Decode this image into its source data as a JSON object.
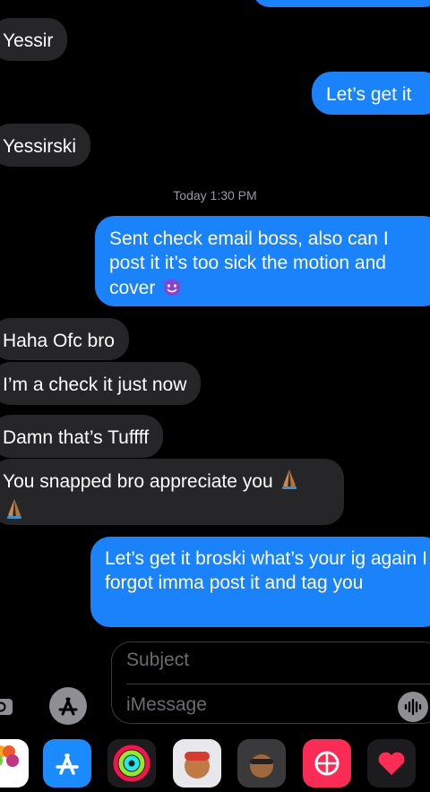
{
  "messages": [
    {
      "direction": "outgoing",
      "text": ""
    },
    {
      "direction": "incoming",
      "text": "Yessir"
    },
    {
      "direction": "outgoing",
      "text": "Let’s get it"
    },
    {
      "direction": "incoming",
      "text": "Yessirski"
    },
    {
      "direction": "outgoing",
      "text": "Sent check email boss, also can I post it it’s too sick the motion and cover"
    },
    {
      "direction": "incoming",
      "text": "Haha Ofc bro"
    },
    {
      "direction": "incoming",
      "text": "I’m a check it just now"
    },
    {
      "direction": "incoming",
      "text": "Damn that’s Tuffff"
    },
    {
      "direction": "incoming",
      "text": "You snapped bro appreciate you"
    },
    {
      "direction": "outgoing",
      "text": "Let’s get it broski what’s your ig again I forgot imma post it and tag you"
    }
  ],
  "timestamp": {
    "day": "Today",
    "time": "1:30 PM",
    "label": "Today 1:30 PM"
  },
  "composer": {
    "subject_placeholder": "Subject",
    "message_placeholder": "iMessage"
  },
  "emojis": {
    "devil": "smiling-imp",
    "pray": "folded-hands"
  },
  "colors": {
    "outgoing": "#1a82fb",
    "incoming": "#262629",
    "background": "#000000",
    "timestamp": "#9a9aa0"
  }
}
